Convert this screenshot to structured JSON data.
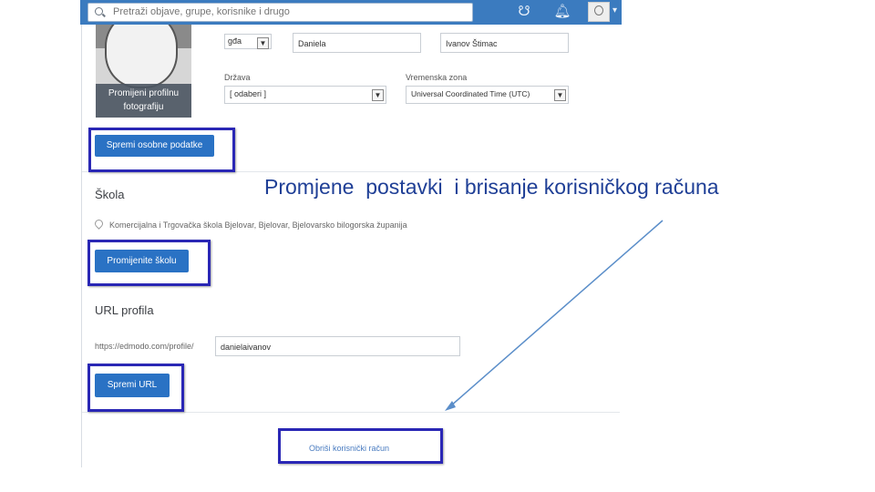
{
  "topbar": {
    "search_placeholder": "Pretraži objave, grupe, korisnike i drugo",
    "colors": {
      "bar": "#3b7bbf",
      "button": "#2a72c4",
      "highlight": "#2a27b5"
    }
  },
  "personal": {
    "change_photo_label": "Promijeni profilnu fotografiju",
    "title_value": "gđa",
    "first_name": "Daniela",
    "last_name": "Ivanov Štimac",
    "country_label": "Država",
    "country_value": "[ odaberi ]",
    "timezone_label": "Vremenska zona",
    "timezone_value": "Universal Coordinated Time (UTC)",
    "save_button": "Spremi osobne podatke"
  },
  "school": {
    "heading": "Škola",
    "value": "Komercijalna i Trgovačka škola Bjelovar, Bjelovar, Bjelovarsko bilogorska županija",
    "change_button": "Promijenite školu"
  },
  "url": {
    "heading": "URL profila",
    "prefix": "https://edmodo.com/profile/",
    "value": "danielaivanov",
    "save_button": "Spremi URL"
  },
  "account": {
    "delete_link": "Obriši korisnički račun"
  },
  "slide_title": "Promjene  postavki  i brisanje korisničkog računa"
}
